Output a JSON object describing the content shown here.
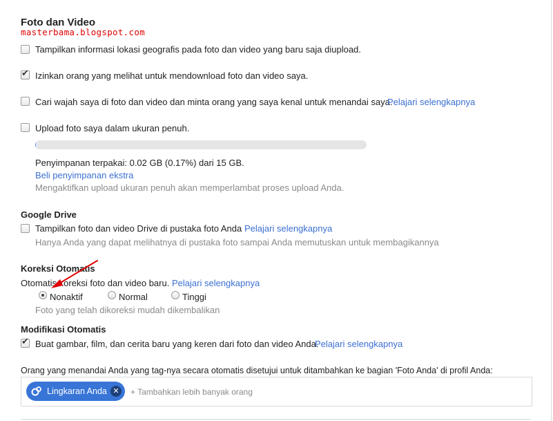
{
  "watermark": "masterbama.blogspot.com",
  "photos": {
    "title": "Foto dan Video",
    "geo_label": "Tampilkan informasi lokasi geografis pada foto dan video yang baru saja diupload.",
    "geo_checked": false,
    "download_label": "Izinkan orang yang melihat untuk mendownload foto dan video saya.",
    "download_checked": true,
    "face_label": "Cari wajah saya di foto dan video dan minta orang yang saya kenal untuk menandai saya.",
    "face_link": "Pelajari selengkapnya",
    "face_checked": false,
    "upload_label": "Upload foto saya dalam ukuran penuh.",
    "upload_checked": false,
    "storage_used_fraction": 0.0017,
    "storage_text": "Penyimpanan terpakai: 0.02 GB (0.17%) dari 15 GB.",
    "buy_storage_link": "Beli penyimpanan ekstra",
    "upload_note": "Mengaktifkan upload ukuran penuh akan memperlambat proses upload Anda."
  },
  "drive": {
    "title": "Google Drive",
    "show_label": "Tampilkan foto dan video Drive di pustaka foto Anda",
    "show_link": "Pelajari selengkapnya",
    "show_checked": false,
    "note": "Hanya Anda yang dapat melihatnya di pustaka foto sampai Anda memutuskan untuk membagikannya"
  },
  "auto_fix": {
    "title": "Koreksi Otomatis",
    "desc": "Otomatis koreksi foto dan video baru.",
    "link": "Pelajari selengkapnya",
    "options": [
      "Nonaktif",
      "Normal",
      "Tinggi"
    ],
    "selected": "Nonaktif",
    "note": "Foto yang telah dikoreksi mudah dikembalikan"
  },
  "auto_awesome": {
    "title": "Modifikasi Otomatis",
    "label": "Buat gambar, film, dan cerita baru yang keren dari foto dan video Anda.",
    "link": "Pelajari selengkapnya",
    "checked": true
  },
  "tag_approval": {
    "desc": "Orang yang menandai Anda yang tag-nya secara otomatis disetujui untuk ditambahkan ke bagian 'Foto Anda' di profil Anda:",
    "chip_label": "Lingkaran Anda",
    "add_more": "+ Tambahkan lebih banyak orang"
  },
  "colors": {
    "link": "#3b6fd2",
    "chip": "#3875d7",
    "annotation_arrow": "#e00000"
  }
}
